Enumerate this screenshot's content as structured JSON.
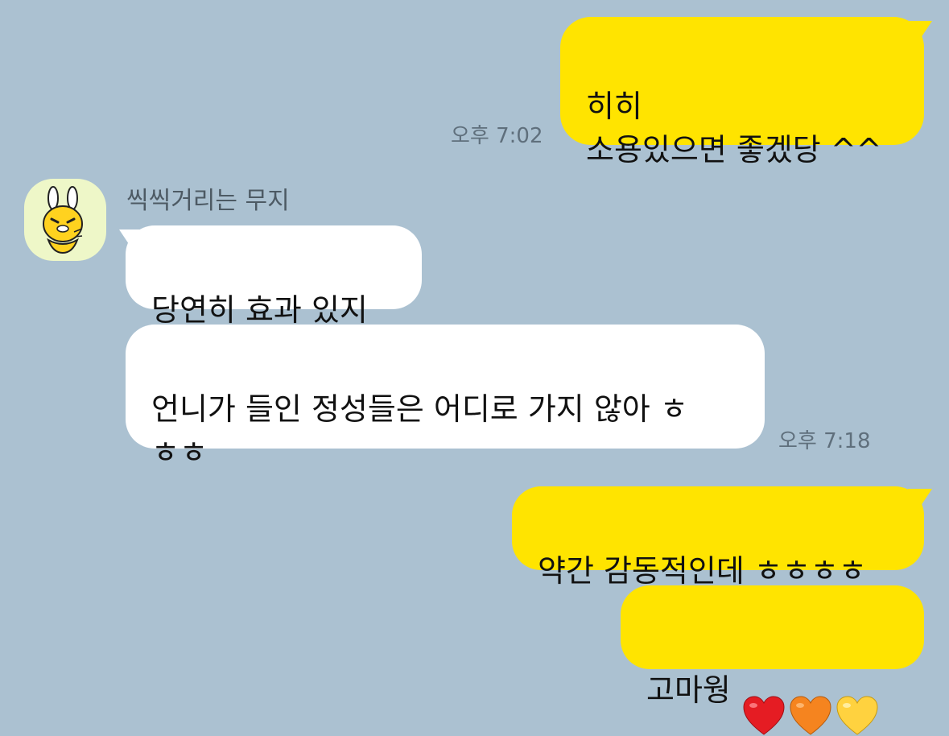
{
  "messages": [
    {
      "side": "me",
      "lines": "히히\n소용있으면 좋겠당 ^^",
      "time": "오후 7:02"
    },
    {
      "side": "them",
      "sender": "씩씩거리는 무지",
      "lines": "당연히 효과 있지"
    },
    {
      "side": "them",
      "lines": "언니가 들인 정성들은 어디로 가지 않아 ㅎ\nㅎㅎ",
      "time": "오후 7:18"
    },
    {
      "side": "me",
      "lines": "약간 감동적인데 ㅎㅎㅎㅎ"
    },
    {
      "side": "me",
      "lines": "고마웡",
      "emoji": [
        "red-heart",
        "orange-heart",
        "yellow-heart"
      ]
    }
  ],
  "colors": {
    "background": "#abc1d1",
    "my_bubble": "#ffe400",
    "their_bubble": "#ffffff",
    "time_text": "#5f6f7c"
  }
}
